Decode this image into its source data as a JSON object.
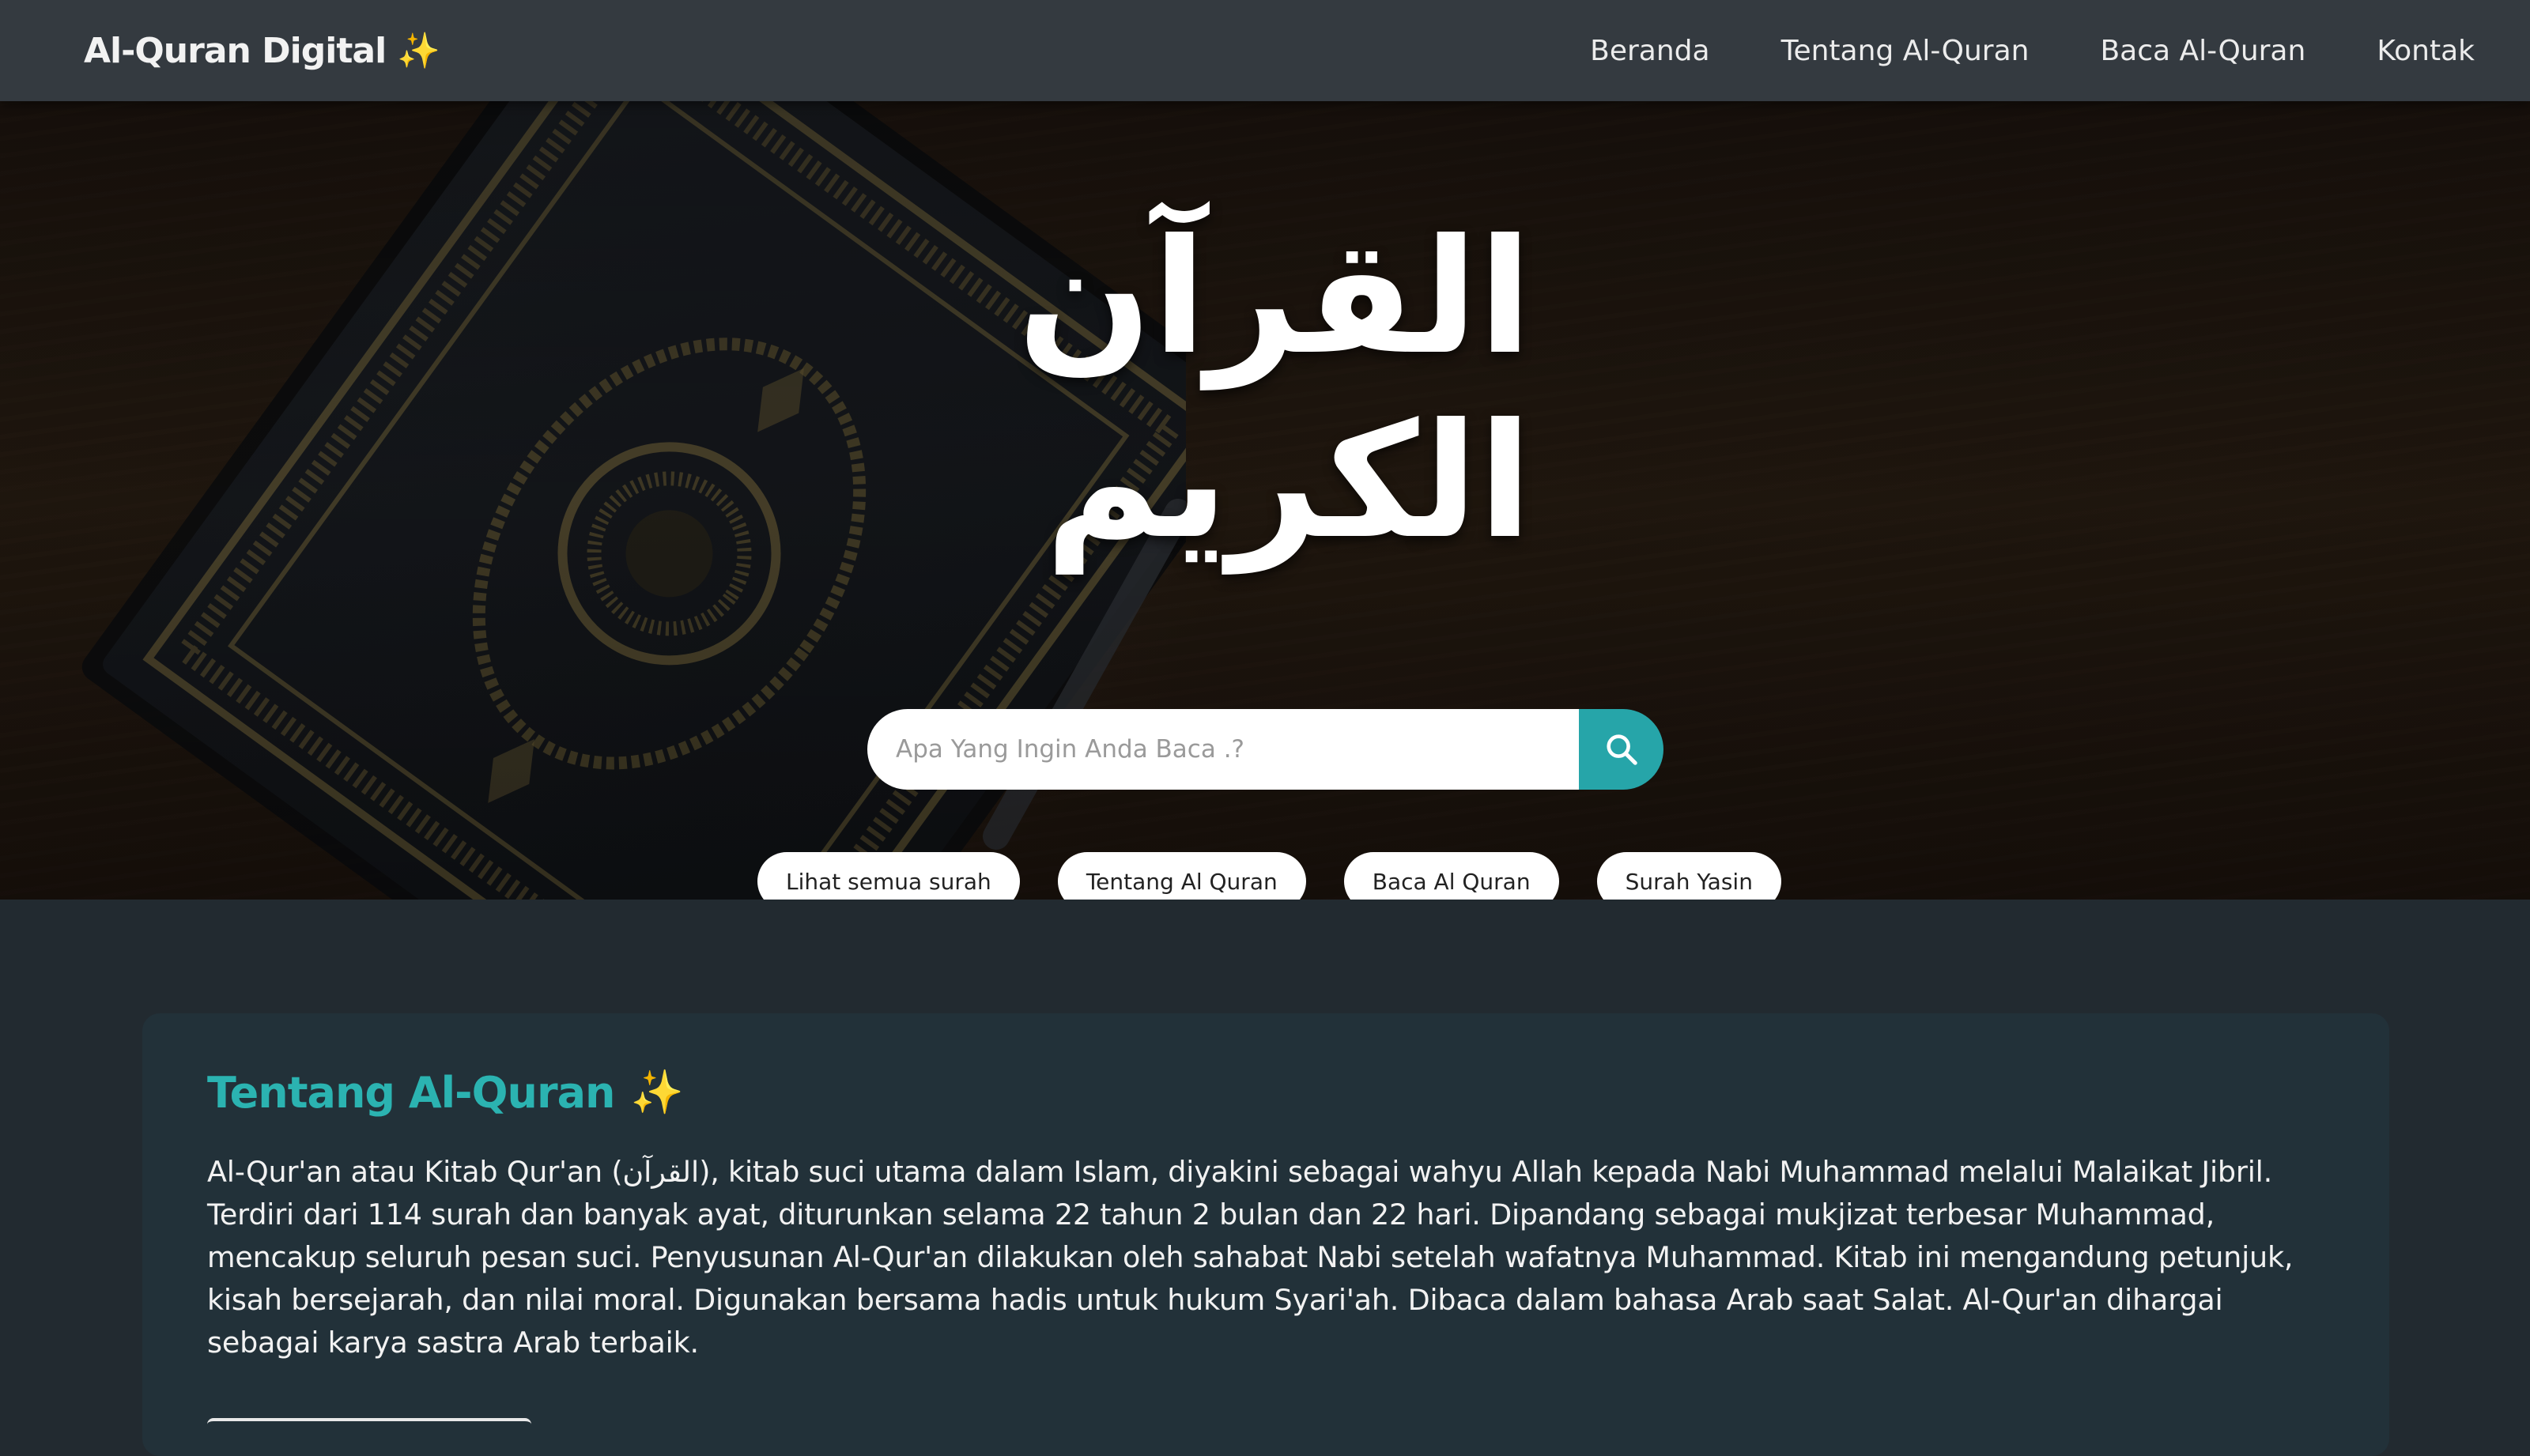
{
  "navbar": {
    "brand": "Al-Quran Digital",
    "brand_icon": "sparkles-icon",
    "links": [
      "Beranda",
      "Tentang Al-Quran",
      "Baca Al-Quran",
      "Kontak"
    ]
  },
  "hero": {
    "calligraphy": "القرآن الكريم",
    "search": {
      "placeholder": "Apa Yang Ingin Anda Baca .?",
      "value": "",
      "button_icon": "search-icon"
    },
    "quick_links": [
      "Lihat semua surah",
      "Tentang Al Quran",
      "Baca Al Quran",
      "Surah Yasin"
    ]
  },
  "about": {
    "title": "Tentang Al-Quran",
    "title_icon": "sparkles-icon",
    "text": "Al-Qur'an atau Kitab Qur'an (القرآن), kitab suci utama dalam Islam, diyakini sebagai wahyu Allah kepada Nabi Muhammad melalui Malaikat Jibril. Terdiri dari 114 surah dan banyak ayat, diturunkan selama 22 tahun 2 bulan dan 22 hari. Dipandang sebagai mukjizat terbesar Muhammad, mencakup seluruh pesan suci. Penyusunan Al-Qur'an dilakukan oleh sahabat Nabi setelah wafatnya Muhammad. Kitab ini mengandung petunjuk, kisah bersejarah, dan nilai moral. Digunakan bersama hadis untuk hukum Syari'ah. Dibaca dalam bahasa Arab saat Salat. Al-Qur'an dihargai sebagai karya sastra Arab terbaik."
  },
  "colors": {
    "navbar": "#343a40",
    "accent": "#26a5a9",
    "title": "#2bb3b1",
    "card": "#223139",
    "page": "#222a30",
    "sparkle": "#f5c518"
  }
}
